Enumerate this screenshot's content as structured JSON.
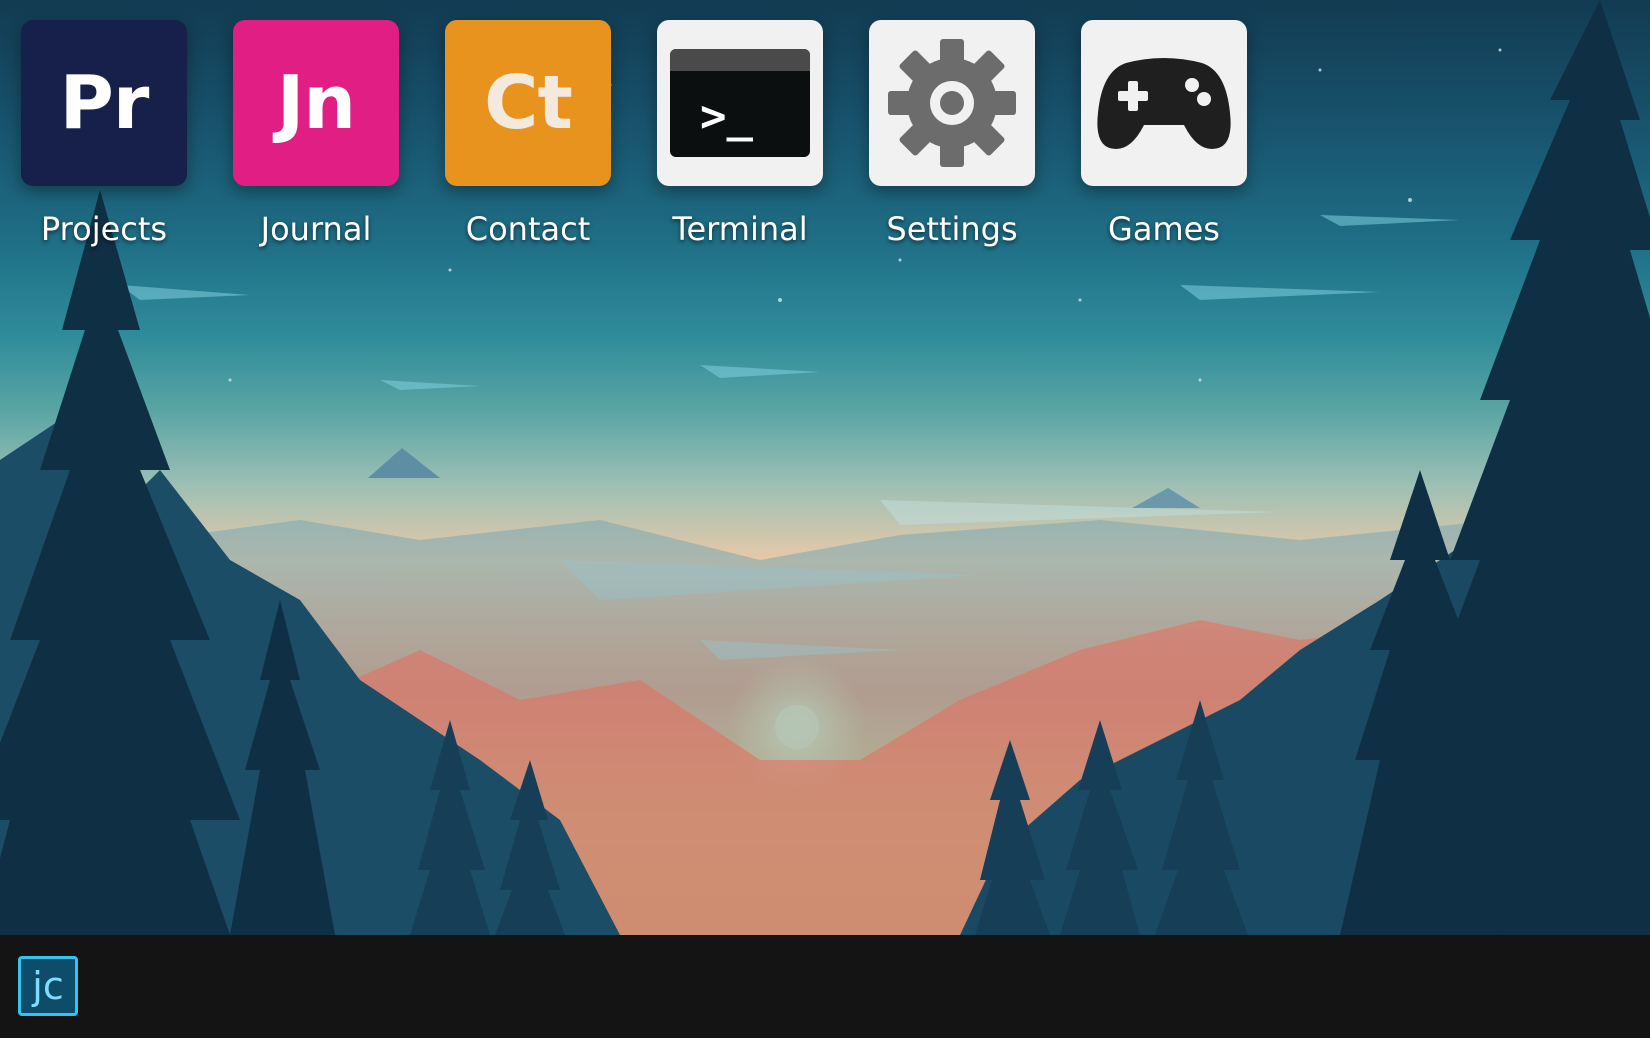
{
  "desktop": {
    "apps": [
      {
        "label": "Projects",
        "tile_text": "Pr",
        "icon": "projects-icon",
        "bg": "#17204a",
        "fg": "#ffffff"
      },
      {
        "label": "Journal",
        "tile_text": "Jn",
        "icon": "journal-icon",
        "bg": "#e01e84",
        "fg": "#ffffff"
      },
      {
        "label": "Contact",
        "tile_text": "Ct",
        "icon": "contact-icon",
        "bg": "#e9931f",
        "fg": "#f3e9dc"
      },
      {
        "label": "Terminal",
        "icon": "terminal-icon",
        "bg": "#f1f1f1",
        "glyph": ">_"
      },
      {
        "label": "Settings",
        "icon": "gear-icon",
        "bg": "#f1f1f1"
      },
      {
        "label": "Games",
        "icon": "gamepad-icon",
        "bg": "#f1f1f1"
      }
    ]
  },
  "taskbar": {
    "start_label": "jc",
    "accent": "#34c4f0"
  }
}
